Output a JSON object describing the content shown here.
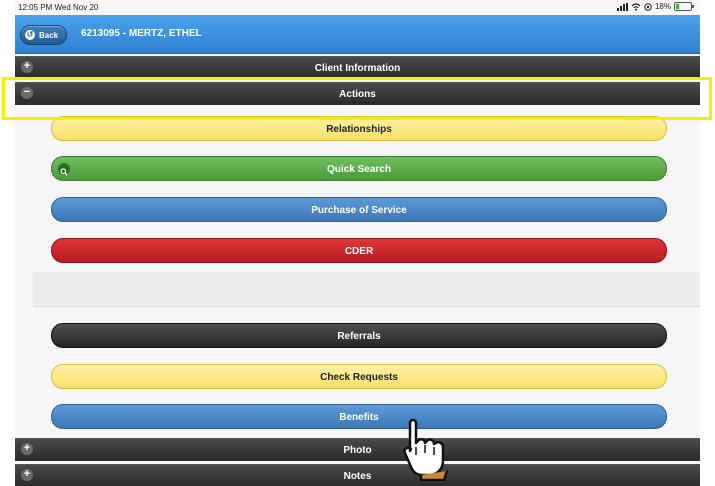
{
  "status_bar": {
    "time": "12:05 PM  Wed Nov 20",
    "battery": "18%"
  },
  "header": {
    "back_label": "Back",
    "title": "6213095 - MERTZ, ETHEL"
  },
  "sections": {
    "client_information": "Client Information",
    "actions": "Actions",
    "photo": "Photo",
    "notes": "Notes"
  },
  "actions": {
    "relationships": "Relationships",
    "quick_search": "Quick Search",
    "purchase_of_service": "Purchase of Service",
    "cder": "CDER",
    "referrals": "Referrals",
    "check_requests": "Check Requests",
    "benefits": "Benefits"
  },
  "colors": {
    "header_blue": "#3b8fdf",
    "highlight": "#f5ef00",
    "yellow_button": "#f7df6a",
    "green_button": "#4a9a3d",
    "blue_button": "#3d77b6",
    "red_button": "#b71d22",
    "dark_button": "#262626"
  }
}
